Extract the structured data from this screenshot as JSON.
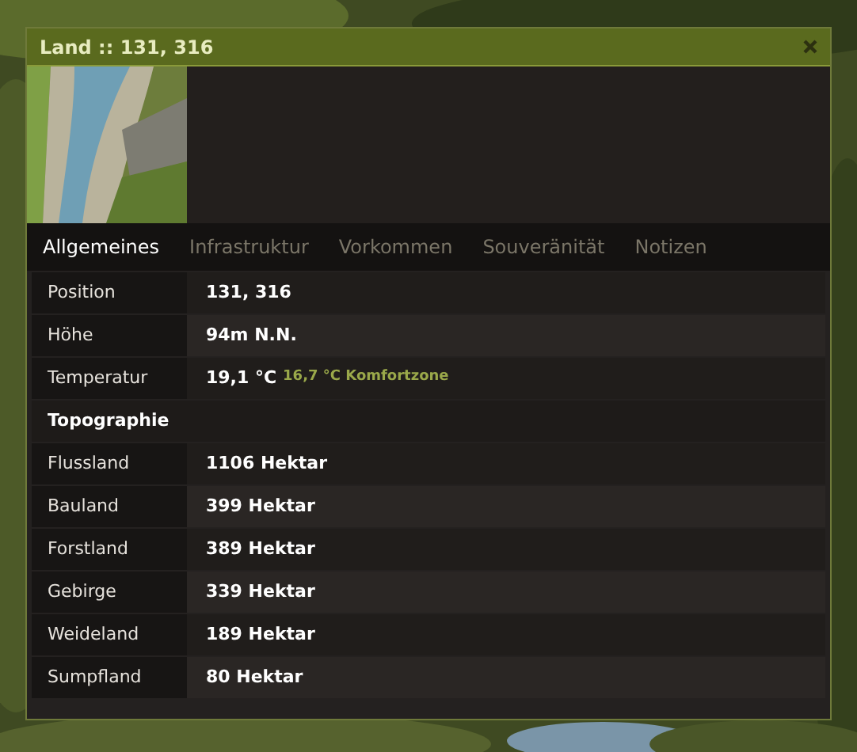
{
  "window": {
    "title": "Land :: 131, 316"
  },
  "tabs": [
    {
      "label": "Allgemeines",
      "selected": true
    },
    {
      "label": "Infrastruktur",
      "selected": false
    },
    {
      "label": "Vorkommen",
      "selected": false
    },
    {
      "label": "Souveränität",
      "selected": false
    },
    {
      "label": "Notizen",
      "selected": false
    }
  ],
  "rows": [
    {
      "kind": "field",
      "label": "Position",
      "value": "131, 316"
    },
    {
      "kind": "field",
      "label": "Höhe",
      "value": "94m N.N."
    },
    {
      "kind": "field",
      "label": "Temperatur",
      "value": "19,1 °C",
      "note": "16,7 °C Komfortzone"
    },
    {
      "kind": "heading",
      "label": "Topographie"
    },
    {
      "kind": "field",
      "label": "Flussland",
      "value": "1106 Hektar"
    },
    {
      "kind": "field",
      "label": "Bauland",
      "value": "399 Hektar"
    },
    {
      "kind": "field",
      "label": "Forstland",
      "value": "389 Hektar"
    },
    {
      "kind": "field",
      "label": "Gebirge",
      "value": "339 Hektar"
    },
    {
      "kind": "field",
      "label": "Weideland",
      "value": "189 Hektar"
    },
    {
      "kind": "field",
      "label": "Sumpfland",
      "value": "80 Hektar"
    }
  ]
}
